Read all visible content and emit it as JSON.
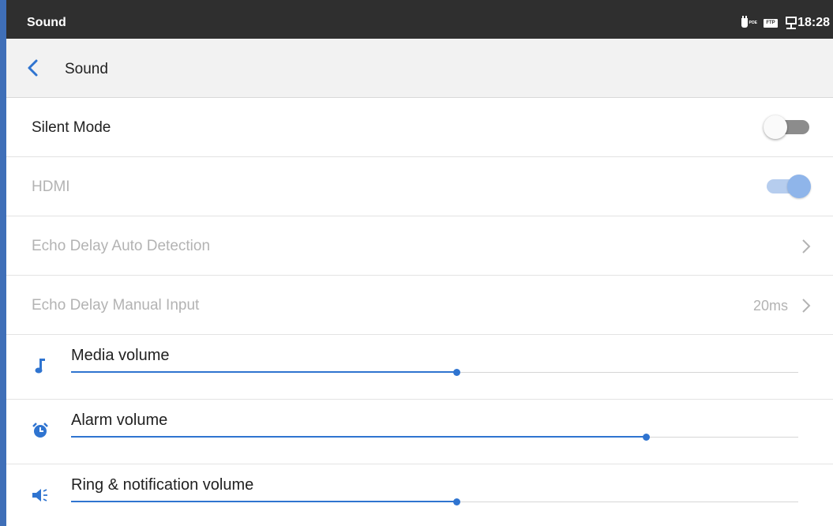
{
  "statusbar": {
    "title": "Sound",
    "time": "18:28",
    "icons": [
      "poe-icon",
      "ftp-icon",
      "network-icon"
    ],
    "poe_tag": "POE",
    "ftp_tag": "FTP"
  },
  "header": {
    "title": "Sound",
    "back_icon": "back-arrow-icon"
  },
  "settings": {
    "silent_mode": {
      "label": "Silent Mode",
      "enabled": false
    },
    "hdmi": {
      "label": "HDMI",
      "enabled": true,
      "disabled": true
    },
    "echo_auto": {
      "label": "Echo Delay Auto Detection",
      "disabled": true
    },
    "echo_manual": {
      "label": "Echo Delay Manual Input",
      "value": "20ms",
      "disabled": true
    }
  },
  "volumes": [
    {
      "label": "Media volume",
      "icon": "music-note-icon",
      "level": 0.53
    },
    {
      "label": "Alarm volume",
      "icon": "alarm-clock-icon",
      "level": 0.79
    },
    {
      "label": "Ring & notification volume",
      "icon": "speaker-icon",
      "level": 0.53
    }
  ],
  "colors": {
    "accent": "#2f74d0",
    "statusbar": "#2f2f2f",
    "header": "#f2f2f2",
    "disabled_text": "#b3b3b3"
  }
}
